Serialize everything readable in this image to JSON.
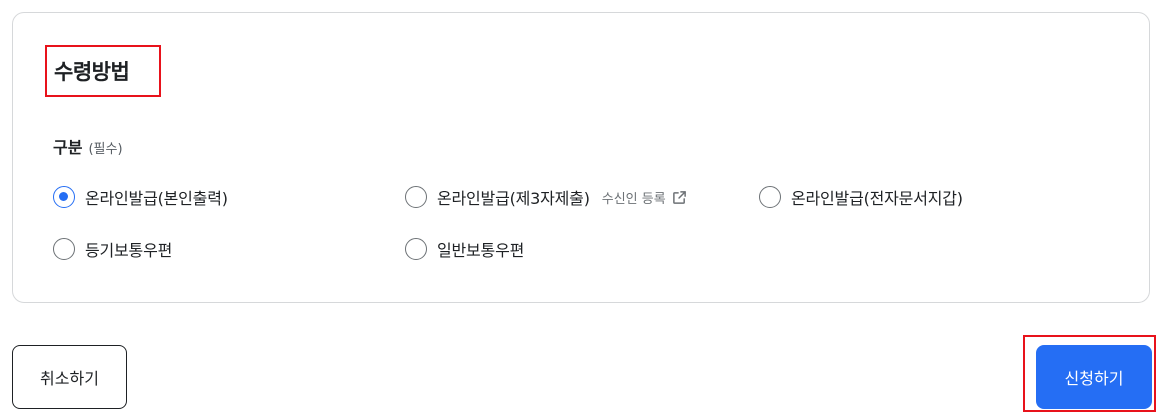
{
  "section": {
    "title": "수령방법"
  },
  "field": {
    "label": "구분",
    "required": "(필수)"
  },
  "options": [
    {
      "label": "온라인발급(본인출력)",
      "checked": true
    },
    {
      "label": "온라인발급(제3자제출)",
      "checked": false,
      "link": "수신인 등록",
      "link_icon": "external-link-icon"
    },
    {
      "label": "온라인발급(전자문서지갑)",
      "checked": false
    },
    {
      "label": "등기보통우편",
      "checked": false
    },
    {
      "label": "일반보통우편",
      "checked": false
    }
  ],
  "buttons": {
    "cancel": "취소하기",
    "apply": "신청하기"
  },
  "colors": {
    "primary": "#256ef4",
    "highlight": "#e8121b",
    "border": "#d6d8da",
    "text": "#1e2124"
  }
}
